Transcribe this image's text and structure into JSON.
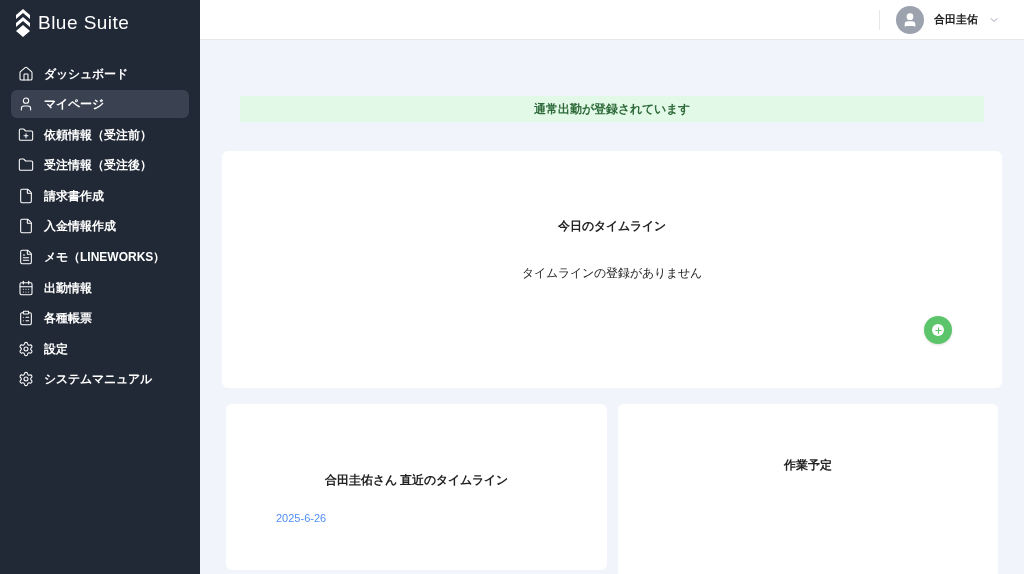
{
  "sidebar": {
    "logo": "Blue Suite",
    "items": [
      {
        "label": "ダッシュボード",
        "selected": false
      },
      {
        "label": "マイページ",
        "selected": true
      },
      {
        "label": "依頼情報（受注前）",
        "selected": false
      },
      {
        "label": "受注情報（受注後）",
        "selected": false
      },
      {
        "label": "請求書作成",
        "selected": false
      },
      {
        "label": "入金情報作成",
        "selected": false
      },
      {
        "label": "メモ（LINEWORKS）",
        "selected": false
      },
      {
        "label": "出勤情報",
        "selected": false
      },
      {
        "label": "各種帳票",
        "selected": false
      },
      {
        "label": "設定",
        "selected": false
      },
      {
        "label": "システムマニュアル",
        "selected": false
      }
    ]
  },
  "header": {
    "user_name": "合田圭佑"
  },
  "banner": "通常出勤が登録されています",
  "today_timeline": {
    "title": "今日のタイムライン",
    "empty_message": "タイムラインの登録がありません"
  },
  "recent_timeline": {
    "title": "合田圭佑さん 直近のタイムライン",
    "dates": [
      "2025-6-26"
    ]
  },
  "work_schedule": {
    "title": "作業予定"
  }
}
